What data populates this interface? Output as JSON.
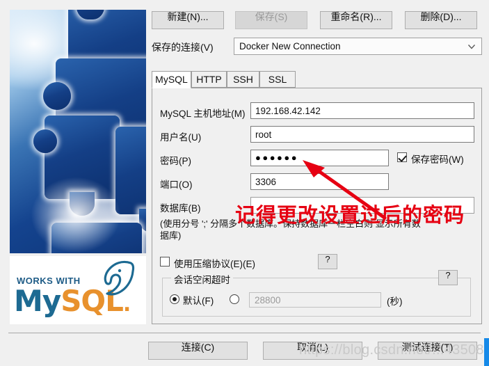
{
  "left_panel": {
    "puzzle_image_alt": "blue-puzzle-pieces",
    "logo": {
      "works_with": "WORKS WITH",
      "my": "My",
      "sql": "SQL",
      "dot": "."
    }
  },
  "toolbar": {
    "new_label": "新建(N)...",
    "save_label": "保存(S)",
    "rename_label": "重命名(R)...",
    "delete_label": "删除(D)..."
  },
  "saved_connection": {
    "label": "保存的连接(V)",
    "value": "Docker New Connection",
    "options": [
      "Docker New Connection"
    ]
  },
  "tabs": [
    {
      "label": "MySQL",
      "active": true
    },
    {
      "label": "HTTP",
      "active": false
    },
    {
      "label": "SSH",
      "active": false
    },
    {
      "label": "SSL",
      "active": false
    }
  ],
  "form": {
    "host": {
      "label": "MySQL 主机地址(M)",
      "value": "192.168.42.142"
    },
    "username": {
      "label": "用户名(U)",
      "value": "root"
    },
    "password": {
      "label": "密码(P)",
      "value": "●●●●●●",
      "masked": true
    },
    "save_password": {
      "label": "保存密码(W)",
      "checked": true
    },
    "port": {
      "label": "端口(O)",
      "value": "3306"
    },
    "database": {
      "label": "数据库(B)",
      "value": "",
      "placeholder": ""
    },
    "database_hint": "(使用分号 ';' 分隔多个数据库。保持数据库一栏空白则\n显示所有数据库)",
    "use_compression": {
      "label": "使用压缩协议(E)(E)",
      "checked": false
    },
    "help_button_1": "?",
    "session_timeout": {
      "legend": "会话空闲超时",
      "default_label": "默认(F)",
      "default_selected": true,
      "custom_selected": false,
      "custom_value": "28800",
      "unit": "(秒)",
      "help_button": "?"
    }
  },
  "footer": {
    "connect_label": "连接(C)",
    "cancel_label": "取消(L)",
    "test_label": "测试连接(T)"
  },
  "overlay": {
    "annotation_text": "记得更改设置过后的密码",
    "annotation_color": "#e60012",
    "arrow": "red-arrow-pointing-to-password-field",
    "watermark": "https://blog.csdn.net/...43508"
  },
  "colors": {
    "window_bg": "#f0f0f0",
    "field_bg": "#ffffff",
    "button_bg": "#e1e1e1",
    "border": "#9e9e9e",
    "annotation_red": "#e60012",
    "mysql_blue": "#1d6a92",
    "mysql_orange": "#e8912d",
    "accent_blue": "#1589e8"
  }
}
